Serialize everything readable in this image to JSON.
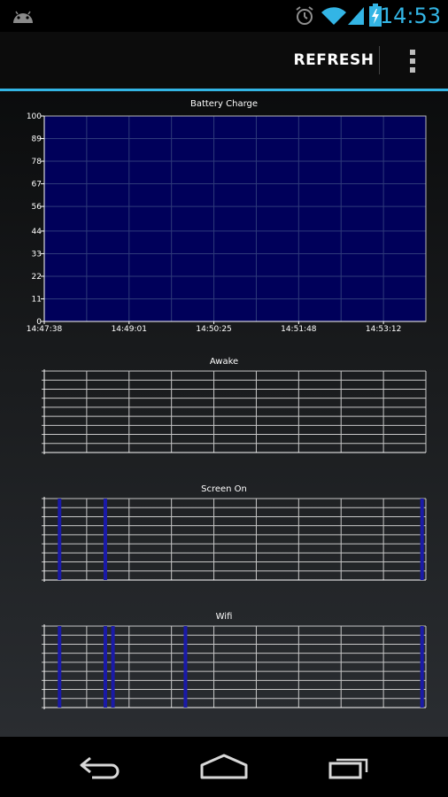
{
  "status_bar": {
    "time": "14:53",
    "icons": [
      "android-icon",
      "alarm-icon",
      "wifi-icon",
      "signal-icon",
      "battery-charging-icon"
    ],
    "accent_color": "#33b5e5"
  },
  "action_bar": {
    "refresh_label": "REFRESH",
    "overflow_icon": "overflow-menu-icon"
  },
  "charts": {
    "battery": {
      "title": "Battery Charge",
      "y_ticks": [
        "100",
        "89",
        "78",
        "67",
        "56",
        "44",
        "33",
        "22",
        "11",
        "0"
      ],
      "x_ticks": [
        "14:47:38",
        "14:49:01",
        "14:50:25",
        "14:51:48",
        "14:53:12"
      ]
    },
    "awake": {
      "title": "Awake"
    },
    "screen_on": {
      "title": "Screen On"
    },
    "wifi": {
      "title": "Wifi"
    }
  },
  "chart_data": [
    {
      "type": "area",
      "title": "Battery Charge",
      "x": [
        "14:47:38",
        "14:49:01",
        "14:50:25",
        "14:51:48",
        "14:53:12"
      ],
      "series": [
        {
          "values": [
            100,
            100,
            100,
            100,
            100
          ]
        }
      ],
      "ylim": [
        0,
        100
      ],
      "y_ticks": [
        100,
        89,
        78,
        67,
        56,
        44,
        33,
        22,
        11,
        0
      ],
      "fill_color": "#00005a",
      "grid": true
    },
    {
      "type": "bar",
      "title": "Awake",
      "event_bars": [],
      "grid": true
    },
    {
      "type": "bar",
      "title": "Screen On",
      "event_bars": [
        0.04,
        0.16,
        0.99
      ],
      "bar_color": "#1a1aa8",
      "grid": true
    },
    {
      "type": "bar",
      "title": "Wifi",
      "event_bars": [
        0.04,
        0.16,
        0.18,
        0.37,
        0.99
      ],
      "bar_color": "#1a1aa8",
      "grid": true
    }
  ],
  "nav_bar": {
    "icons": [
      "back-icon",
      "home-icon",
      "recent-apps-icon"
    ]
  }
}
